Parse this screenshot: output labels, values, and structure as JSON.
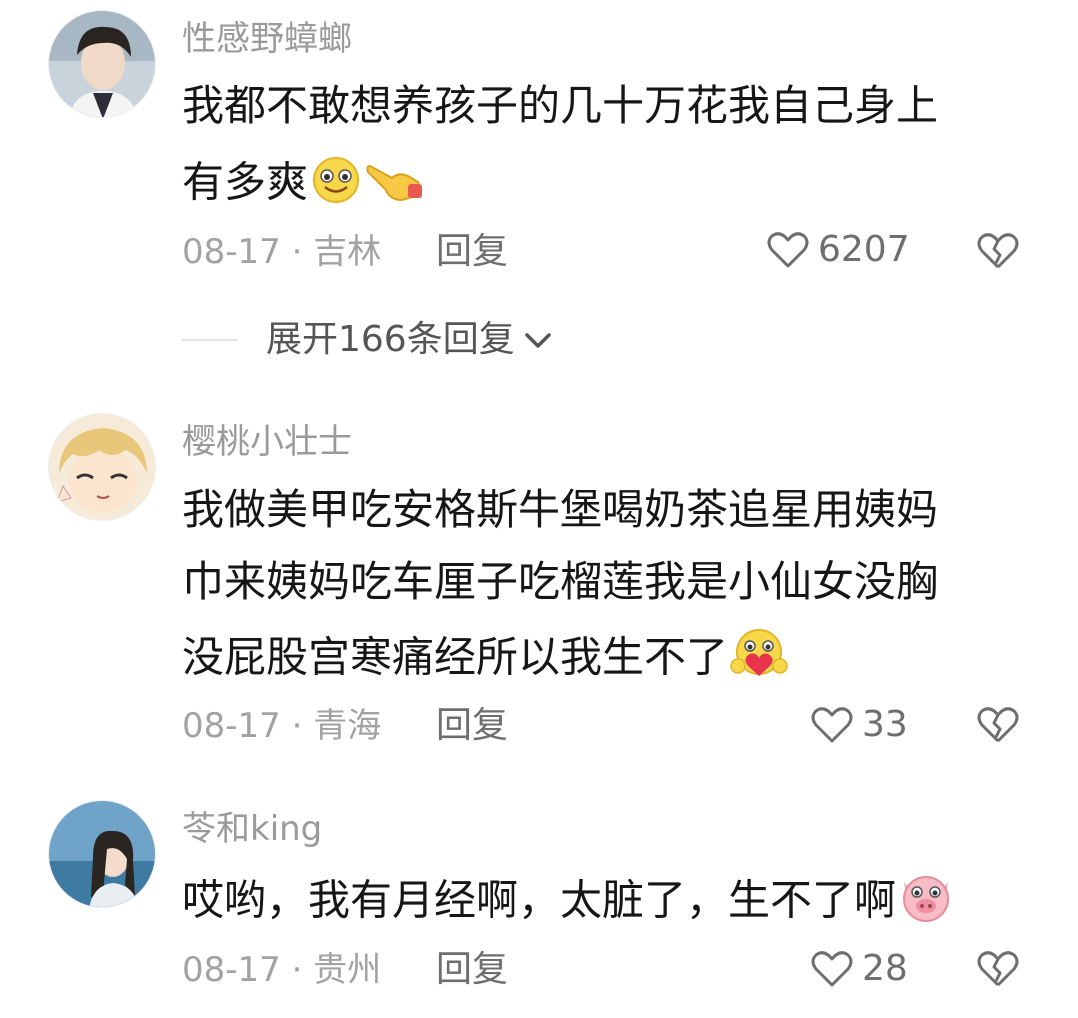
{
  "comments": [
    {
      "username": "性感野蟑螂",
      "lines": [
        "我都不敢想养孩子的几十万花我自己身上",
        "有多爽"
      ],
      "date_location": "08-17 · 吉林",
      "reply_label": "回复",
      "likes": "6207",
      "emojis": [
        "smiling-face-emoji",
        "pointing-hand-emoji"
      ],
      "expand_label": "展开166条回复"
    },
    {
      "username": "樱桃小壮士",
      "lines": [
        "我做美甲吃安格斯牛堡喝奶茶追星用姨妈",
        "巾来姨妈吃车厘子吃榴莲我是小仙女没胸",
        "没屁股宫寒痛经所以我生不了"
      ],
      "date_location": "08-17 · 青海",
      "reply_label": "回复",
      "likes": "33",
      "emojis": [
        "heart-hug-emoji"
      ]
    },
    {
      "username": "苓和king",
      "lines": [
        "哎哟，我有月经啊，太脏了，生不了啊"
      ],
      "date_location": "08-17 · 贵州",
      "reply_label": "回复",
      "likes": "28",
      "emojis": [
        "pig-face-emoji"
      ]
    }
  ],
  "colors": {
    "username": "#9a9a9a",
    "text": "#161616",
    "meta": "#a2a2a2",
    "action": "#6e6e6e"
  }
}
